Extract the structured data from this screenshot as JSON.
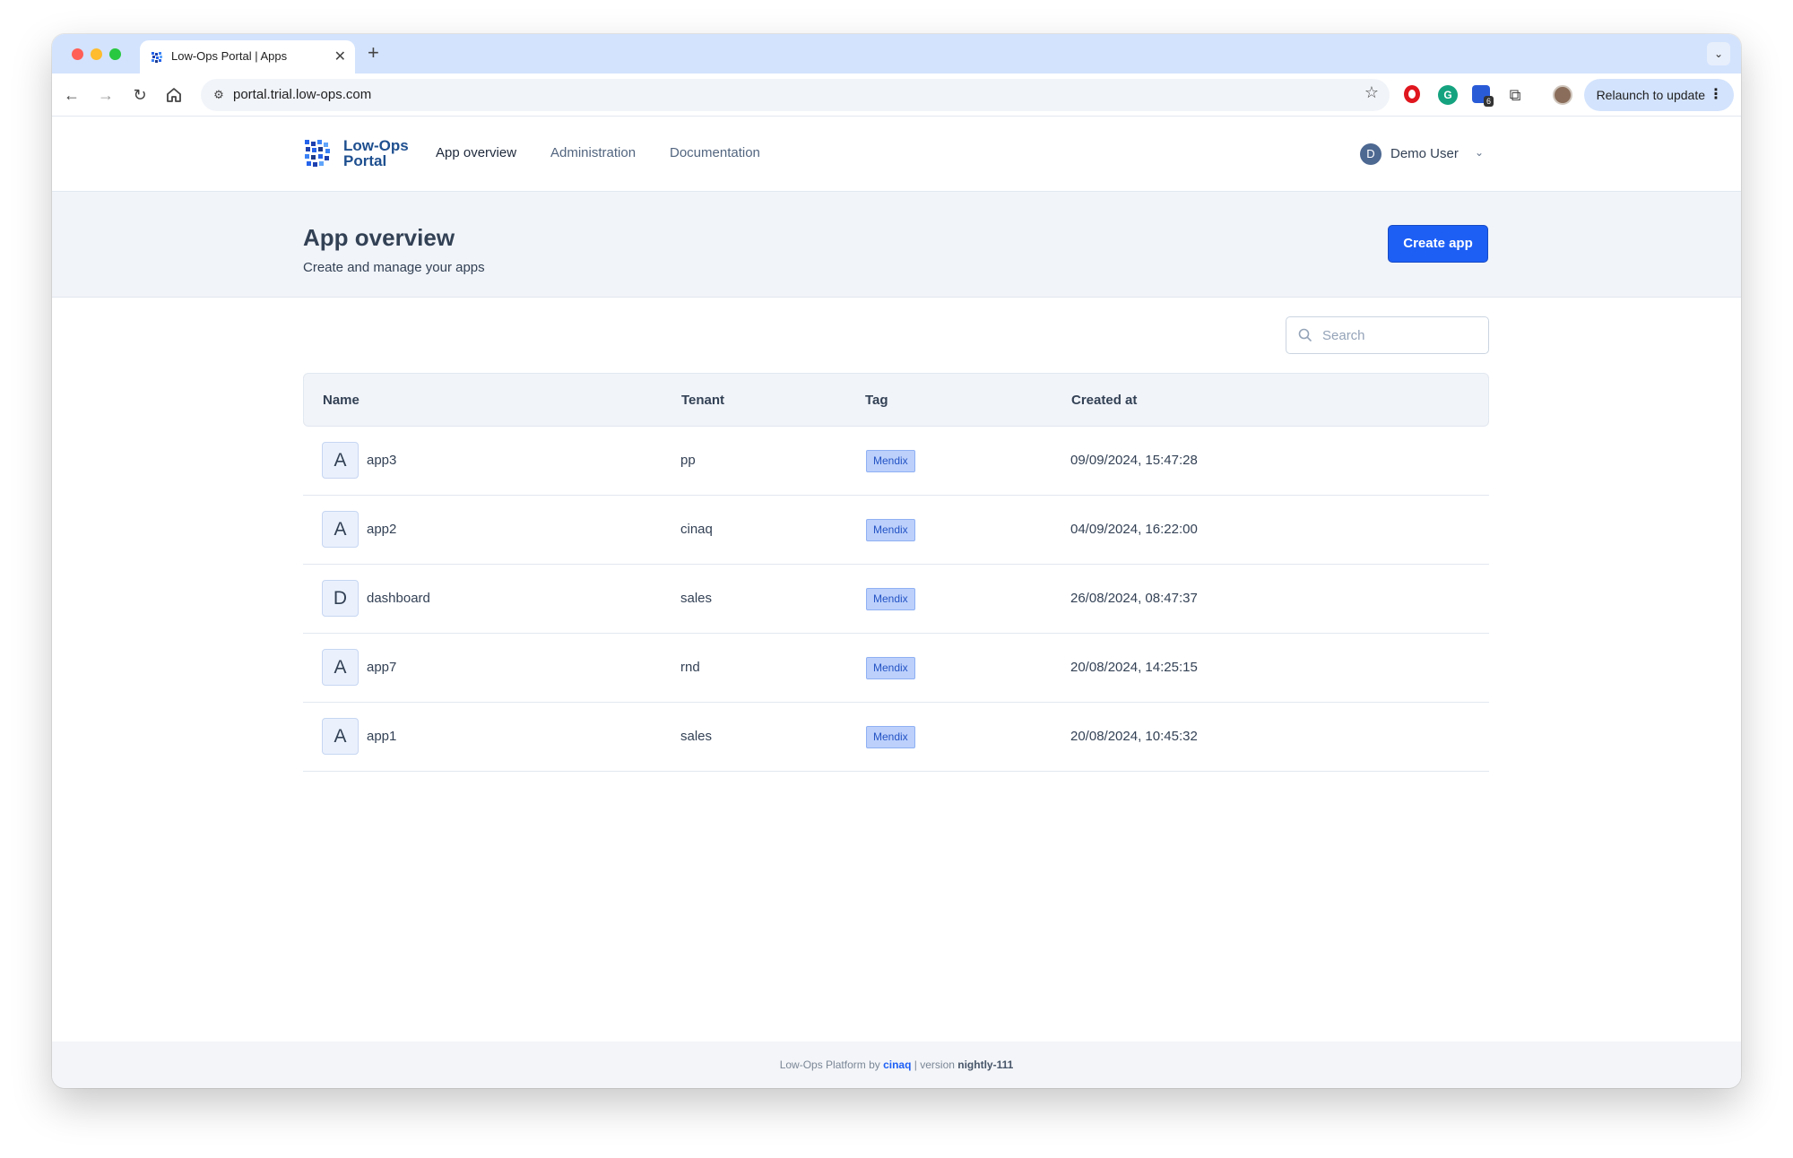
{
  "browser": {
    "tab_title": "Low-Ops Portal | Apps",
    "url": "portal.trial.low-ops.com",
    "relaunch_label": "Relaunch to update",
    "extension_badge": "6"
  },
  "header": {
    "logo_line1": "Low-Ops",
    "logo_line2": "Portal",
    "nav": [
      "App overview",
      "Administration",
      "Documentation"
    ],
    "user_initial": "D",
    "user_name": "Demo User"
  },
  "page": {
    "title": "App overview",
    "subtitle": "Create and manage your apps",
    "create_label": "Create app"
  },
  "search": {
    "placeholder": "Search",
    "value": ""
  },
  "table": {
    "columns": [
      "Name",
      "Tenant",
      "Tag",
      "Created at"
    ],
    "rows": [
      {
        "initial": "A",
        "name": "app3",
        "tenant": "pp",
        "tag": "Mendix",
        "created": "09/09/2024, 15:47:28"
      },
      {
        "initial": "A",
        "name": "app2",
        "tenant": "cinaq",
        "tag": "Mendix",
        "created": "04/09/2024, 16:22:00"
      },
      {
        "initial": "D",
        "name": "dashboard",
        "tenant": "sales",
        "tag": "Mendix",
        "created": "26/08/2024, 08:47:37"
      },
      {
        "initial": "A",
        "name": "app7",
        "tenant": "rnd",
        "tag": "Mendix",
        "created": "20/08/2024, 14:25:15"
      },
      {
        "initial": "A",
        "name": "app1",
        "tenant": "sales",
        "tag": "Mendix",
        "created": "20/08/2024, 10:45:32"
      }
    ]
  },
  "footer": {
    "prefix": "Low-Ops Platform by",
    "brand": "cinaq",
    "separator": "| version",
    "version": "nightly-111"
  },
  "colors": {
    "accent": "#1d5ff5",
    "tag_bg": "#bcd0fb",
    "header_band": "#f1f4f9",
    "chrome_tabstrip": "#d3e3fd"
  }
}
